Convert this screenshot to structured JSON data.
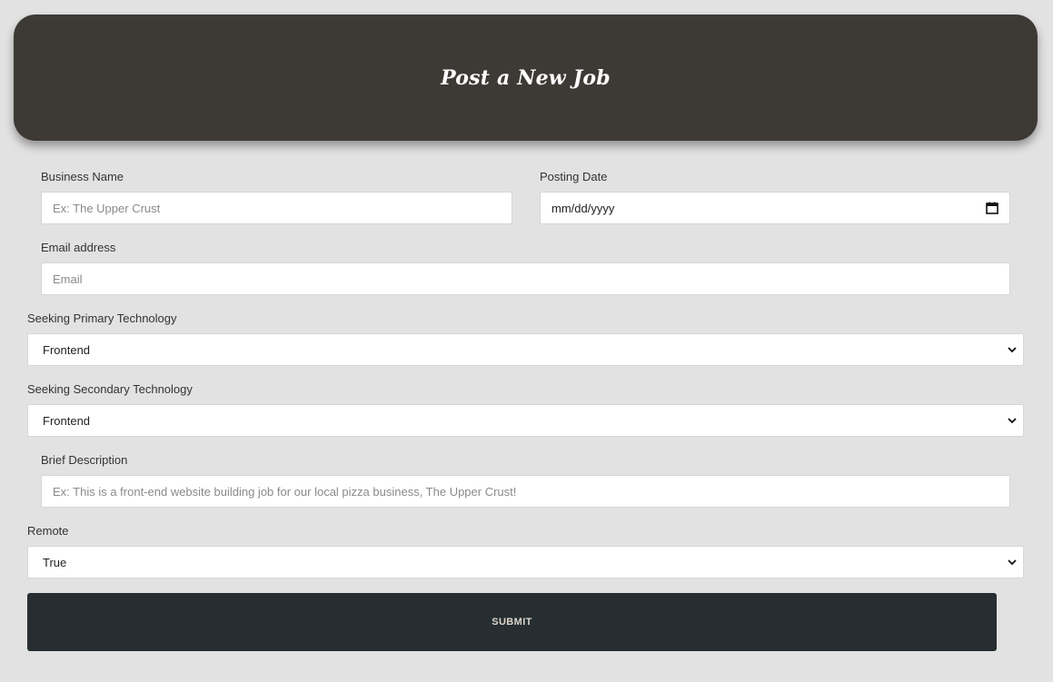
{
  "header": {
    "title": "Post a New Job"
  },
  "form": {
    "business_name": {
      "label": "Business Name",
      "placeholder": "Ex: The Upper Crust",
      "value": ""
    },
    "posting_date": {
      "label": "Posting Date",
      "display": "mm/dd/yyyy",
      "icon": "calendar-icon"
    },
    "email": {
      "label": "Email address",
      "placeholder": "Email",
      "value": ""
    },
    "primary_tech": {
      "label": "Seeking Primary Technology",
      "selected": "Frontend",
      "icon": "chevron-down-icon"
    },
    "secondary_tech": {
      "label": "Seeking Secondary Technology",
      "selected": "Frontend",
      "icon": "chevron-down-icon"
    },
    "description": {
      "label": "Brief Description",
      "placeholder": "Ex: This is a front-end website building job for our local pizza business, The Upper Crust!",
      "value": ""
    },
    "remote": {
      "label": "Remote",
      "selected": "True",
      "icon": "chevron-down-icon"
    },
    "submit_label": "SUBMIT"
  },
  "colors": {
    "background": "#e2e2e2",
    "header_bg": "#3d3a36",
    "submit_bg": "#262e31",
    "submit_text": "#ddd6cc"
  }
}
